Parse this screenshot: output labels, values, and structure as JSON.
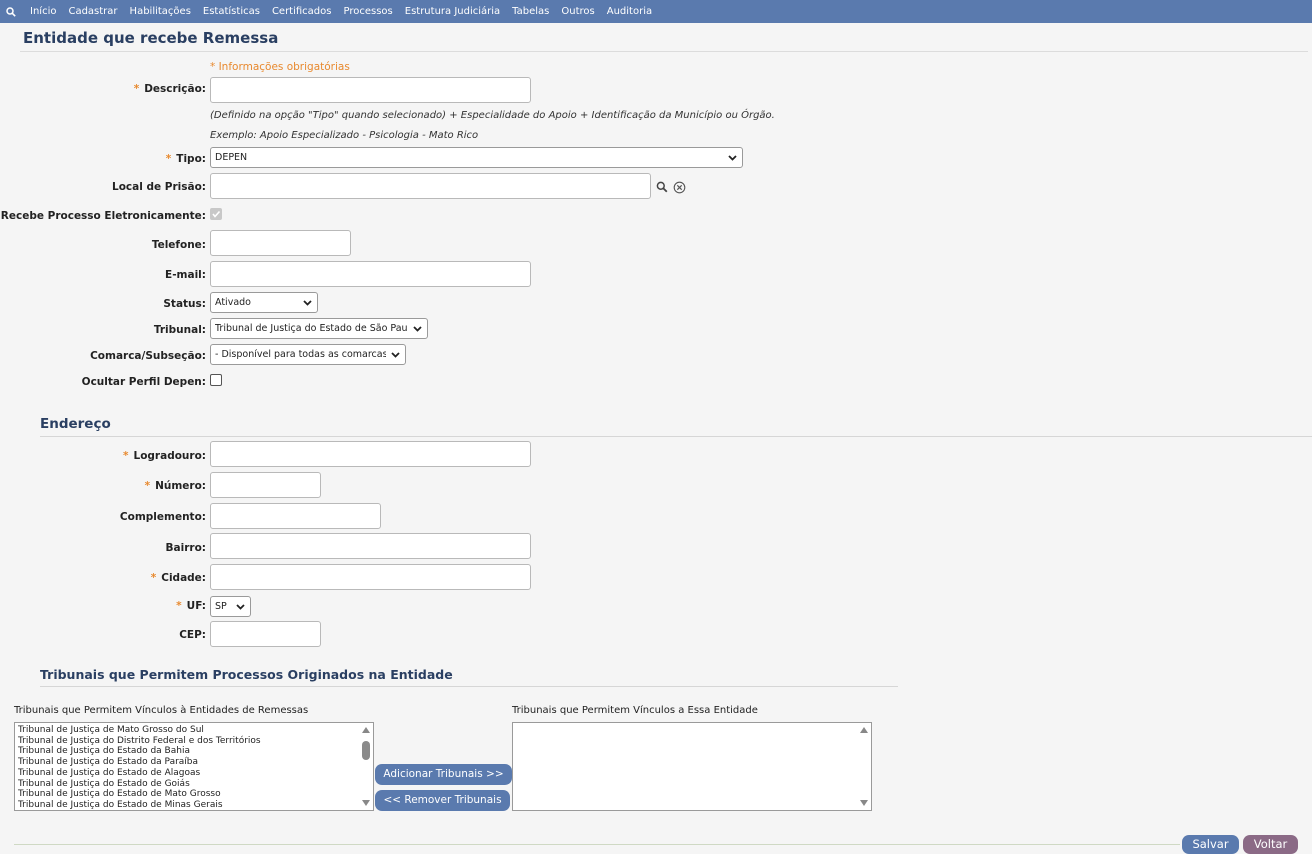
{
  "nav": {
    "items": [
      "Início",
      "Cadastrar",
      "Habilitações",
      "Estatísticas",
      "Certificados",
      "Processos",
      "Estrutura Judiciária",
      "Tabelas",
      "Outros",
      "Auditoria"
    ]
  },
  "page_title": "Entidade que recebe Remessa",
  "required_note": "* Informações obrigatórias",
  "form": {
    "descricao": {
      "label": "Descrição:",
      "value": ""
    },
    "hint1": "(Definido na opção \"Tipo\" quando selecionado) + Especialidade do Apoio + Identificação da Município ou Órgão.",
    "hint2": "Exemplo: Apoio Especializado - Psicologia - Mato Rico",
    "tipo": {
      "label": "Tipo:",
      "value": "DEPEN"
    },
    "local_prisao": {
      "label": "Local de Prisão:",
      "value": ""
    },
    "recebe_processo": {
      "label": "Recebe Processo Eletronicamente:",
      "checked": true
    },
    "telefone": {
      "label": "Telefone:",
      "value": ""
    },
    "email": {
      "label": "E-mail:",
      "value": ""
    },
    "status": {
      "label": "Status:",
      "value": "Ativado"
    },
    "tribunal": {
      "label": "Tribunal:",
      "value": "Tribunal de Justiça do Estado de São Paulo"
    },
    "comarca": {
      "label": "Comarca/Subseção:",
      "value": "- Disponível para todas as comarcas -"
    },
    "ocultar_perfil": {
      "label": "Ocultar Perfil Depen:",
      "checked": false
    }
  },
  "endereco": {
    "title": "Endereço",
    "logradouro": {
      "label": "Logradouro:",
      "value": ""
    },
    "numero": {
      "label": "Número:",
      "value": ""
    },
    "complemento": {
      "label": "Complemento:",
      "value": ""
    },
    "bairro": {
      "label": "Bairro:",
      "value": ""
    },
    "cidade": {
      "label": "Cidade:",
      "value": ""
    },
    "uf": {
      "label": "UF:",
      "value": "SP"
    },
    "cep": {
      "label": "CEP:",
      "value": ""
    }
  },
  "tribunais": {
    "title": "Tribunais que Permitem Processos Originados na Entidade",
    "left_label": "Tribunais que Permitem Vínculos à Entidades de Remessas",
    "right_label": "Tribunais que Permitem Vínculos a Essa Entidade",
    "available": [
      "Tribunal de Justiça de Mato Grosso do Sul",
      "Tribunal de Justiça do Distrito Federal e dos Territórios",
      "Tribunal de Justiça do Estado da Bahia",
      "Tribunal de Justiça do Estado da Paraíba",
      "Tribunal de Justiça do Estado de Alagoas",
      "Tribunal de Justiça do Estado de Goiás",
      "Tribunal de Justiça do Estado de Mato Grosso",
      "Tribunal de Justiça do Estado de Minas Gerais"
    ],
    "selected": [],
    "add_button": "Adicionar Tribunais >>",
    "remove_button": "<< Remover Tribunais"
  },
  "actions": {
    "save": "Salvar",
    "back": "Voltar"
  },
  "colors": {
    "nav_bg": "#5a7aae",
    "title": "#2a3f62",
    "required": "#e8892e",
    "button": "#5a7aae",
    "button_secondary": "#8b6a86"
  }
}
